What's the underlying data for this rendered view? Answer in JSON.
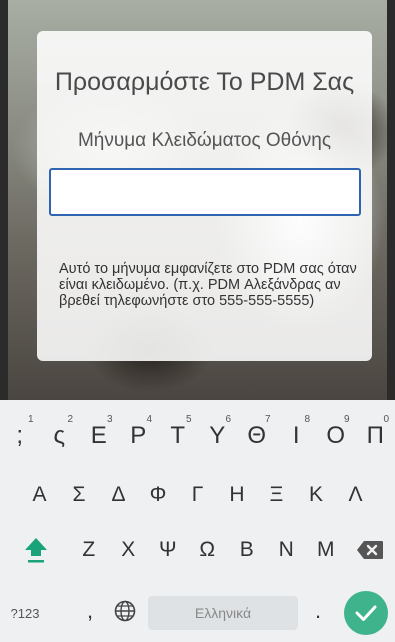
{
  "card": {
    "title": "Προσαρμόστε Το PDM Σας",
    "subtitle": "Μήνυμα Κλειδώματος Οθόνης",
    "input_value": "",
    "help_text": "Αυτό το μήνυμα εμφανίζετε στο PDM σας όταν είναι κλειδωμένο. (π.χ. PDM Αλεξάνδρας αν βρεθεί τηλεφωνήστε στο 555-555-5555)"
  },
  "keyboard": {
    "row1": [
      {
        "label": ";",
        "hint": "1"
      },
      {
        "label": "ς",
        "hint": "2"
      },
      {
        "label": "Ε",
        "hint": "3"
      },
      {
        "label": "Ρ",
        "hint": "4"
      },
      {
        "label": "Τ",
        "hint": "5"
      },
      {
        "label": "Υ",
        "hint": "6"
      },
      {
        "label": "Θ",
        "hint": "7"
      },
      {
        "label": "Ι",
        "hint": "8"
      },
      {
        "label": "Ο",
        "hint": "9"
      },
      {
        "label": "Π",
        "hint": "0"
      }
    ],
    "row2": [
      "Α",
      "Σ",
      "Δ",
      "Φ",
      "Γ",
      "Η",
      "Ξ",
      "Κ",
      "Λ"
    ],
    "row3": [
      "Ζ",
      "Χ",
      "Ψ",
      "Ω",
      "Β",
      "Ν",
      "Μ"
    ],
    "bottom": {
      "symbols_label": "?123",
      "comma_label": ",",
      "space_label": "Ελληνικά",
      "period_label": "."
    }
  },
  "colors": {
    "accent": "#2f64b0",
    "shift_active": "#1aa37a",
    "enter": "#3fb38b"
  },
  "icons": [
    "shift-icon",
    "backspace-icon",
    "globe-icon",
    "checkmark-icon"
  ]
}
